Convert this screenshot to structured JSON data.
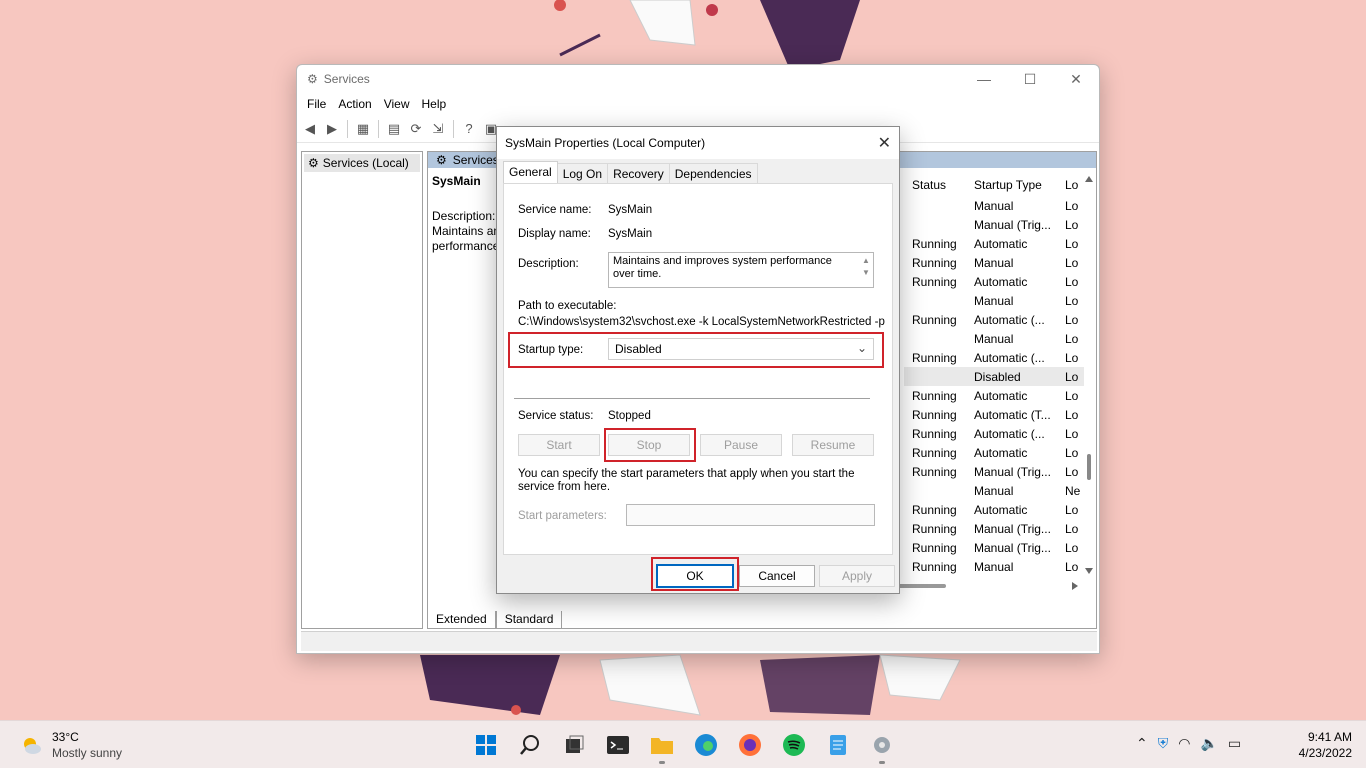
{
  "window": {
    "title": "Services",
    "menu": [
      "File",
      "Action",
      "View",
      "Help"
    ],
    "tree_item": "Services (Local)",
    "main_header": "Services (Local)",
    "selected_name": "SysMain",
    "desc_label": "Description:",
    "desc_line1": "Maintains and improves system",
    "desc_line2": "performance over time.",
    "columns": {
      "status": "Status",
      "startup_type": "Startup Type",
      "logon": "Lo"
    },
    "rows": [
      {
        "status": "",
        "startup": "Manual",
        "logon": "Lo"
      },
      {
        "status": "",
        "startup": "Manual (Trig...",
        "logon": "Lo"
      },
      {
        "status": "Running",
        "startup": "Automatic",
        "logon": "Lo"
      },
      {
        "status": "Running",
        "startup": "Manual",
        "logon": "Lo"
      },
      {
        "status": "Running",
        "startup": "Automatic",
        "logon": "Lo"
      },
      {
        "status": "",
        "startup": "Manual",
        "logon": "Lo"
      },
      {
        "status": "Running",
        "startup": "Automatic (...",
        "logon": "Lo"
      },
      {
        "status": "",
        "startup": "Manual",
        "logon": "Lo"
      },
      {
        "status": "Running",
        "startup": "Automatic (...",
        "logon": "Lo"
      },
      {
        "status": "",
        "startup": "Disabled",
        "logon": "Lo"
      },
      {
        "status": "Running",
        "startup": "Automatic",
        "logon": "Lo"
      },
      {
        "status": "Running",
        "startup": "Automatic (T...",
        "logon": "Lo"
      },
      {
        "status": "Running",
        "startup": "Automatic (...",
        "logon": "Lo"
      },
      {
        "status": "Running",
        "startup": "Automatic",
        "logon": "Lo"
      },
      {
        "status": "Running",
        "startup": "Manual (Trig...",
        "logon": "Lo"
      },
      {
        "status": "",
        "startup": "Manual",
        "logon": "Ne"
      },
      {
        "status": "Running",
        "startup": "Automatic",
        "logon": "Lo"
      },
      {
        "status": "Running",
        "startup": "Manual (Trig...",
        "logon": "Lo"
      },
      {
        "status": "Running",
        "startup": "Manual (Trig...",
        "logon": "Lo"
      },
      {
        "status": "Running",
        "startup": "Manual",
        "logon": "Lo"
      }
    ],
    "bottom_tabs": [
      "Extended",
      "Standard"
    ]
  },
  "dialog": {
    "title": "SysMain Properties (Local Computer)",
    "tabs": [
      "General",
      "Log On",
      "Recovery",
      "Dependencies"
    ],
    "service_name_label": "Service name:",
    "service_name": "SysMain",
    "display_name_label": "Display name:",
    "display_name": "SysMain",
    "description_label": "Description:",
    "description": "Maintains and improves system performance over time.",
    "path_label": "Path to executable:",
    "path": "C:\\Windows\\system32\\svchost.exe -k LocalSystemNetworkRestricted -p",
    "startup_type_label": "Startup type:",
    "startup_type": "Disabled",
    "service_status_label": "Service status:",
    "service_status": "Stopped",
    "buttons": {
      "start": "Start",
      "stop": "Stop",
      "pause": "Pause",
      "resume": "Resume"
    },
    "params_note": "You can specify the start parameters that apply when you start the service from here.",
    "start_params_label": "Start parameters:",
    "start_params_value": "",
    "ok": "OK",
    "cancel": "Cancel",
    "apply": "Apply"
  },
  "taskbar": {
    "temperature": "33°C",
    "condition": "Mostly sunny",
    "time": "9:41 AM",
    "date": "4/23/2022",
    "pinned": [
      "windows-start-icon",
      "search-icon",
      "task-view-icon",
      "terminal-icon",
      "file-explorer-icon",
      "edge-icon",
      "firefox-icon",
      "spotify-icon",
      "notepad-icon",
      "services-icon"
    ]
  },
  "colors": {
    "desktop": "#f7c7c0",
    "highlight_red": "#d0232a",
    "accent_blue": "#0067c0"
  }
}
